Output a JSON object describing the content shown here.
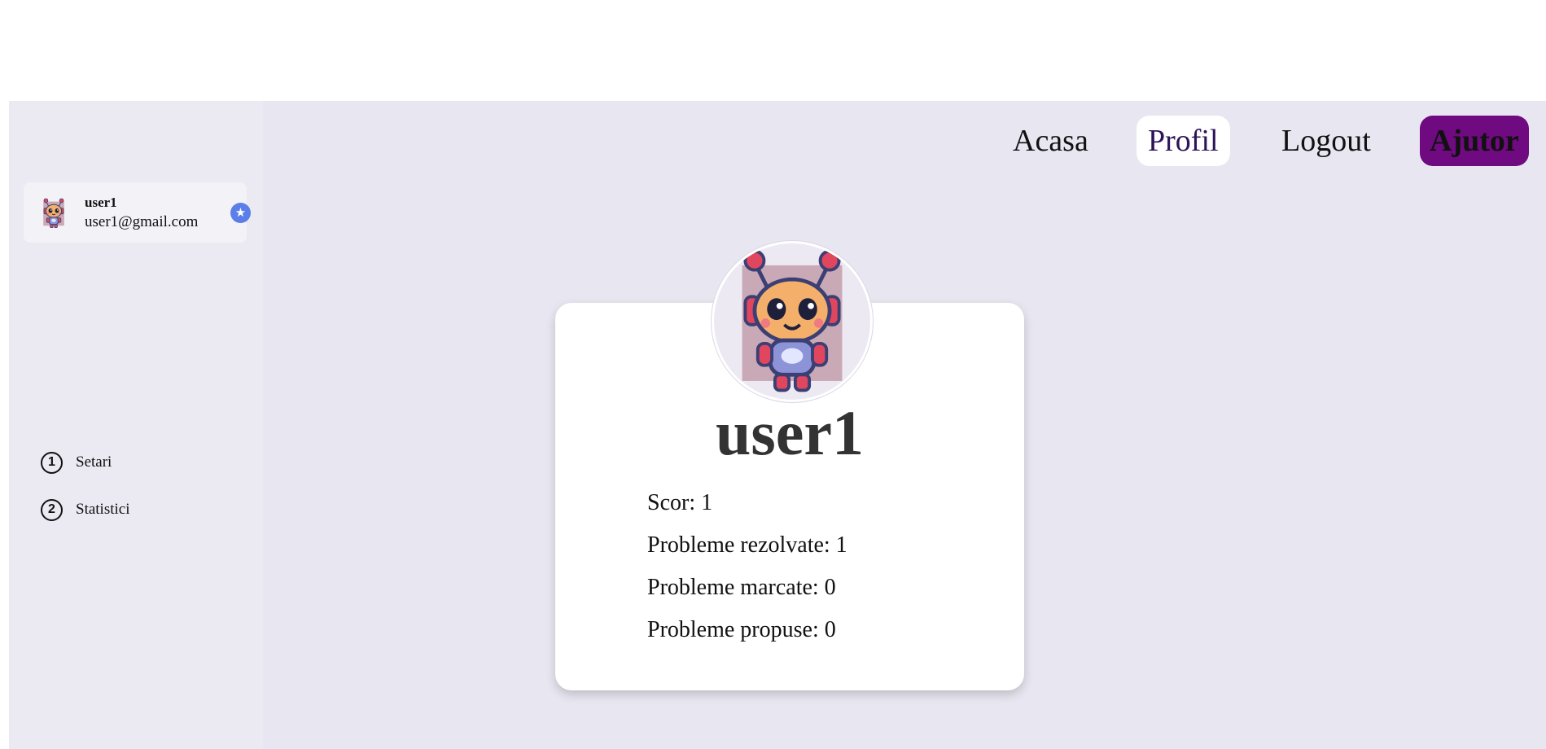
{
  "nav": {
    "acasa": "Acasa",
    "profil": "Profil",
    "logout": "Logout",
    "ajutor": "Ajutor"
  },
  "user": {
    "name": "user1",
    "email": "user1@gmail.com",
    "avatar_icon": "robot-avatar-icon",
    "badge_icon": "star-icon"
  },
  "sidebar": {
    "items": [
      {
        "number": "1",
        "label": "Setari"
      },
      {
        "number": "2",
        "label": "Statistici"
      }
    ]
  },
  "profile": {
    "username": "user1",
    "stats": [
      {
        "text": "Scor: 1"
      },
      {
        "text": "Probleme rezolvate: 1"
      },
      {
        "text": "Probleme marcate: 0"
      },
      {
        "text": "Probleme propuse: 0"
      }
    ]
  },
  "colors": {
    "app_background": "#e8e6f0",
    "active_nav_text": "#2c1458",
    "help_button": "#6f0a80",
    "badge": "#5b7fe8"
  }
}
